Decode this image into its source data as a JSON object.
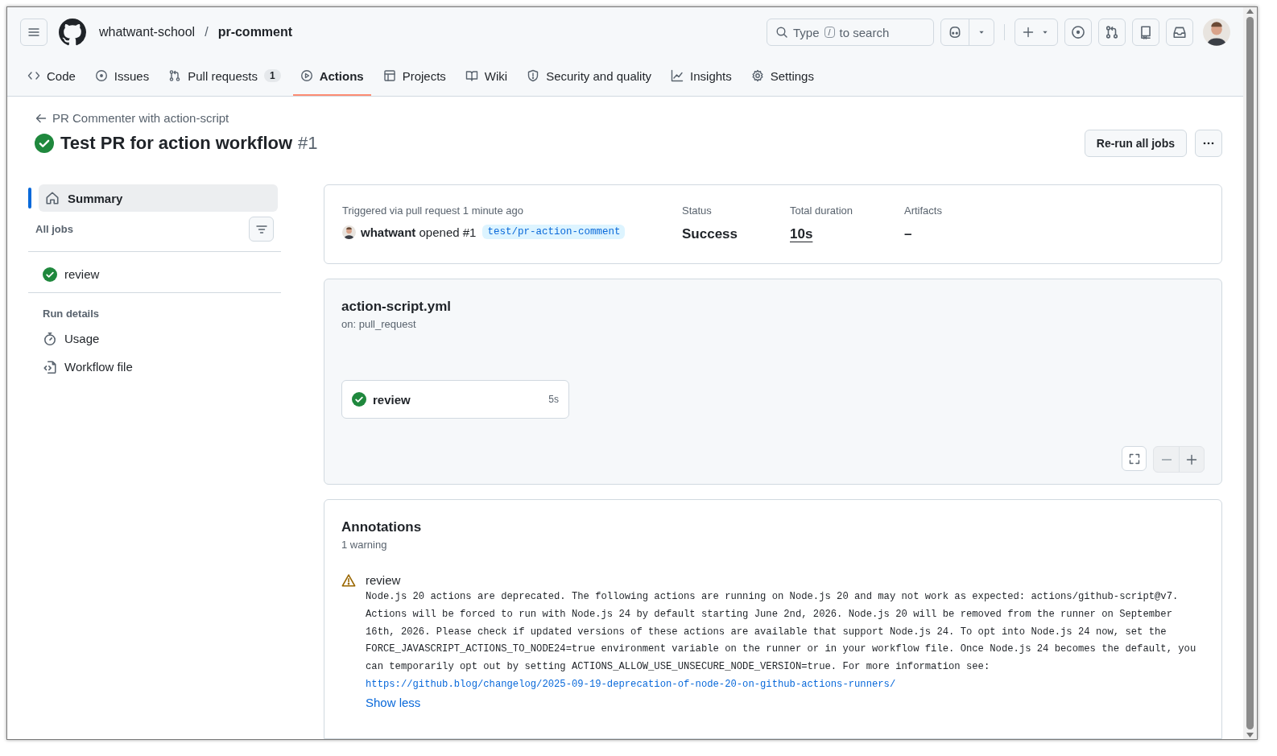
{
  "header": {
    "owner": "whatwant-school",
    "separator": "/",
    "repo": "pr-comment",
    "search": {
      "placeholder_before": "Type",
      "key": "/",
      "placeholder_after": "to search"
    }
  },
  "tabs": [
    {
      "label": "Code",
      "selected": false
    },
    {
      "label": "Issues",
      "selected": false
    },
    {
      "label": "Pull requests",
      "selected": false,
      "count": "1"
    },
    {
      "label": "Actions",
      "selected": true
    },
    {
      "label": "Projects",
      "selected": false
    },
    {
      "label": "Wiki",
      "selected": false
    },
    {
      "label": "Security and quality",
      "selected": false
    },
    {
      "label": "Insights",
      "selected": false
    },
    {
      "label": "Settings",
      "selected": false
    }
  ],
  "run": {
    "back_link": "PR Commenter with action-script",
    "title": "Test PR for action workflow",
    "number": "#1",
    "rerun_button": "Re-run all jobs"
  },
  "sidebar": {
    "summary": {
      "label": "Summary",
      "selected": true
    },
    "jobs_heading": "All jobs",
    "jobs": [
      {
        "label": "review"
      }
    ],
    "details_heading": "Run details",
    "details": [
      {
        "label": "Usage"
      },
      {
        "label": "Workflow file"
      }
    ]
  },
  "summary_card": {
    "trigger": "Triggered via pull request 1 minute ago",
    "actor": "whatwant",
    "action": "opened #1",
    "branch": "test/pr-action-comment",
    "status_label": "Status",
    "status": "Success",
    "duration_label": "Total duration",
    "duration": "10s",
    "artifacts_label": "Artifacts",
    "artifacts": "–"
  },
  "workflow": {
    "file": "action-script.yml",
    "trigger": "on: pull_request",
    "jobs": [
      {
        "name": "review",
        "time": "5s"
      }
    ]
  },
  "annotations": {
    "title": "Annotations",
    "count": "1 warning",
    "items": [
      {
        "job": "review",
        "message": "Node.js 20 actions are deprecated. The following actions are running on Node.js 20 and may not work as expected: actions/github-script@v7. Actions will be forced to run with Node.js 24 by default starting June 2nd, 2026. Node.js 20 will be removed from the runner on September 16th, 2026. Please check if updated versions of these actions are available that support Node.js 24. To opt into Node.js 24 now, set the FORCE_JAVASCRIPT_ACTIONS_TO_NODE24=true environment variable on the runner or in your workflow file. Once Node.js 24 becomes the default, you can temporarily opt out by setting ACTIONS_ALLOW_USE_UNSECURE_NODE_VERSION=true. For more information see:",
        "link": "https://github.blog/changelog/2025-09-19-deprecation-of-node-20-on-github-actions-runners/",
        "toggle": "Show less"
      }
    ]
  }
}
